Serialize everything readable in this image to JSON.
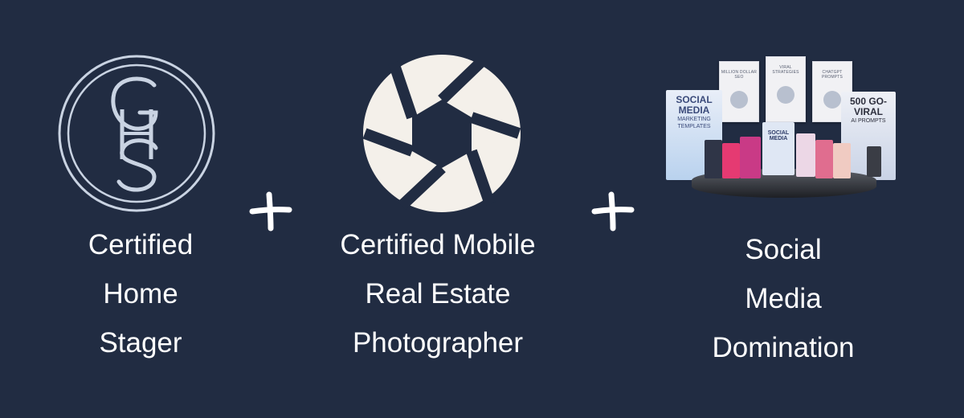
{
  "columns": [
    {
      "label": "Certified\nHome\nStager",
      "icon": "gs-monogram-icon"
    },
    {
      "label": "Certified Mobile\nReal Estate\nPhotographer",
      "icon": "camera-shutter-icon"
    },
    {
      "label": "Social\nMedia\nDomination",
      "icon": "product-bundle-image"
    }
  ],
  "plus_symbols": [
    "plus-icon",
    "plus-icon"
  ],
  "bundle": {
    "screens": [
      "MILLION DOLLAR SEO",
      "VIRAL STRATEGIES",
      "CHATGPT PROMPTS"
    ],
    "left_book": {
      "title": "SOCIAL MEDIA",
      "subtitle": "MARKETING TEMPLATES"
    },
    "right_book": {
      "title": "500 GO-VIRAL",
      "subtitle": "AI PROMPTS"
    },
    "center_book": "SOCIAL MEDIA"
  },
  "colors": {
    "background": "#212c42",
    "text": "#ffffff",
    "logo_outline": "#c9d3e2",
    "shutter": "#f4f0ea"
  }
}
